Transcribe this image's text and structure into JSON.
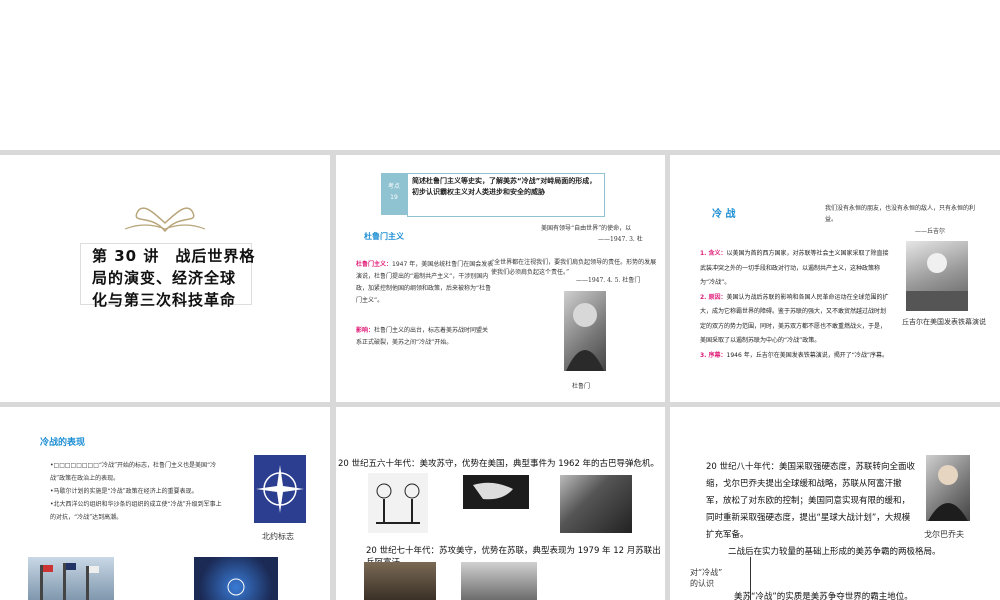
{
  "slide1": {
    "title_lines": [
      "第 30 讲　战后世界格",
      "局的演变、经济全球",
      "化与第三次科技革命"
    ]
  },
  "slide2": {
    "badge_line1": "考点",
    "badge_line2": "19",
    "header_text": "简述杜鲁门主义等史实，了解美苏“冷战”对峙局面的形成，初步认识霸权主义对人类进步和安全的威胁",
    "section_title": "杜鲁门主义",
    "quote1": "美国有领导“自由世界”的使命，以",
    "quote1_src": "——1947. 3. 杜",
    "quote2": "“全世界都在注视我们，要我们肩负起领导的责任。形势的发展使我们必须肩负起这个责任。”",
    "quote2_src": "——1947. 4. 5. 杜鲁门",
    "label_doctrine": "杜鲁门主义：",
    "text_doctrine": "1947 年，美国总统杜鲁门在国会发表演说，杜鲁门提出的“遏制共产主义”，干涉别国内政，加紧控制他国的纲领和政策，后来被称为“杜鲁门主义”。",
    "label_impact": "影响：",
    "text_impact": "杜鲁门主义的出台，标志着美苏战时同盟关系正式破裂，美苏之间“冷战”开始。",
    "photo_caption": "杜鲁门"
  },
  "slide3": {
    "title": "冷 战",
    "quote": "我们没有永恒的朋友，也没有永恒的敌人，只有永恒的利益。",
    "quote_src": "——丘吉尔",
    "p1_label": "1. 含义：",
    "p1_text": "以美国为首的西方国家，对苏联等社会主义国家采取了除直接武装冲突之外的一切手段和政对行动，以遏制共产主义，这种政策称为“冷战”。",
    "p2_label": "2. 原因：",
    "p2_text": "美国认为战后苏联的影响和各国人民革命运动在全球范围的扩大，成为它称霸世界的障碍。鉴于苏联的强大，又不敢贸然越过战时划定的双方的势力范围，同时，美苏双方都不愿也不敢重燃战火，于是，美国采取了以遏制苏联为中心的“冷战”政策。",
    "p3_label": "3. 序幕：",
    "p3_text": "1946 年，丘吉尔在美国发表铁幕演说，揭开了“冷战”序幕。",
    "photo_caption": "丘吉尔在美国发表铁幕演说"
  },
  "slide4": {
    "title": "冷战的表现",
    "bullet1": "•□□□□□□□□“冷战”开始的标志，杜鲁门主义也是美国“冷战”政策在政治上的表现。",
    "bullet2": "•马歇尔计划的实施是“冷战”政策在经济上的重要表现。",
    "bullet3": "•北大西洋公约组织和华沙条约组织的成立使“冷战”升级到军事上的对抗，“冷战”达到高潮。",
    "nato_caption": "北约标志"
  },
  "slide5": {
    "line1": "20 世纪五六十年代：美攻苏守，优势在美国，典型事件为 1962 年的古巴导弹危机。",
    "line2": "20 世纪七十年代：苏攻美守，优势在苏联，典型表现为 1979 年 12 月苏联出兵阿富汗。"
  },
  "slide6": {
    "text1": "20 世纪八十年代：美国采取强硬态度，苏联转向全面收缩，戈尔巴乔夫提出全球缓和战略，苏联从阿富汗撤军，放松了对东欧的控制；美国同意实现有限的缓和，同时重新采取强硬态度，提出“星球大战计划”，大规模扩充军备。",
    "photo_caption": "戈尔巴乔夫",
    "side_label_1": "对“冷战”",
    "side_label_2": "的认识",
    "point1": "二战后在实力较量的基础上形成的美苏争霸的两极格局。",
    "point2": "美苏“冷战”的实质是美苏争夺世界的霸主地位。"
  },
  "colors": {
    "badge_bg": "#8fc3d1",
    "accent_pink": "#e0207a",
    "accent_blue": "#1e8fd4"
  }
}
